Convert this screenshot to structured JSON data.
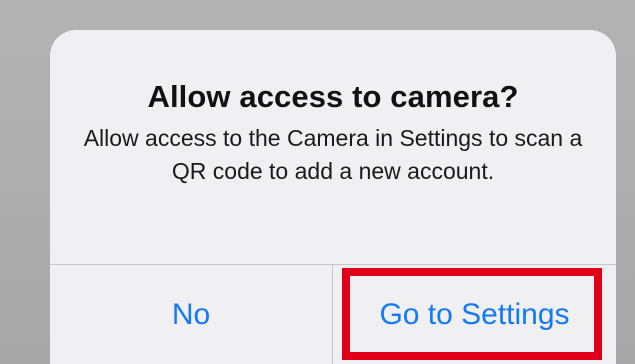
{
  "dialog": {
    "title": "Allow access to camera?",
    "message": "Allow access to the Camera in Settings to scan a QR code to add a new account.",
    "buttons": {
      "no_label": "No",
      "settings_label": "Go to Settings"
    }
  },
  "colors": {
    "backdrop": "#a9a9a9",
    "dialog_background": "#f0f0f2",
    "button_text": "#1479f5",
    "divider": "#c6c6c8",
    "highlight": "#e1001a"
  }
}
